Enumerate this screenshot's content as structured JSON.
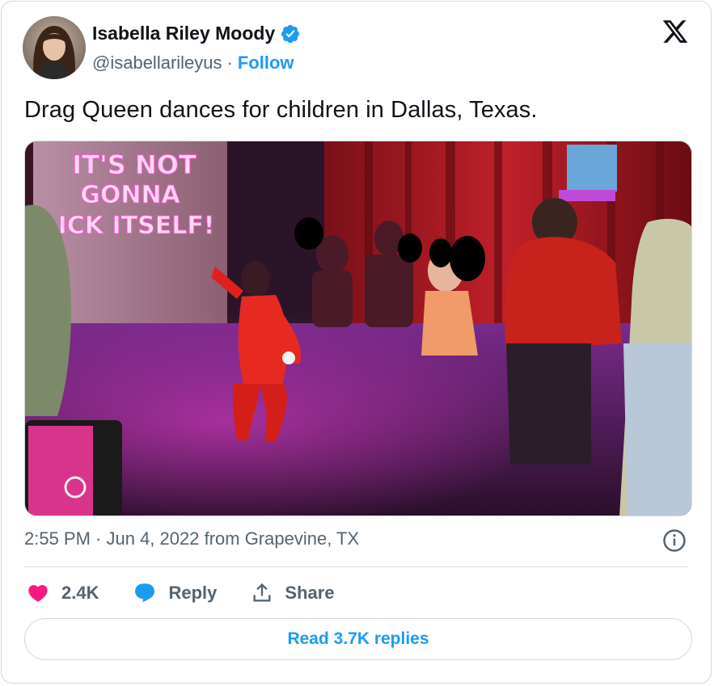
{
  "author": {
    "name": "Isabella Riley Moody",
    "handle": "@isabellarileyus",
    "separator": "·",
    "follow_label": "Follow",
    "verified_icon": "verified-badge-icon"
  },
  "tweet": {
    "text": "Drag Queen dances for children in Dallas, Texas.",
    "timestamp": "2:55 PM · Jun 4, 2022 from Grapevine, TX",
    "media_sign_text": [
      "IT'S NOT",
      "GONNA",
      "LICK ITSELF!"
    ]
  },
  "actions": {
    "like_count": "2.4K",
    "reply_label": "Reply",
    "share_label": "Share"
  },
  "read_replies_label": "Read 3.7K replies",
  "colors": {
    "accent": "#1d9bf0",
    "like": "#f91880",
    "text_primary": "#0f1419",
    "text_secondary": "#536471",
    "border": "#cfd9de"
  }
}
